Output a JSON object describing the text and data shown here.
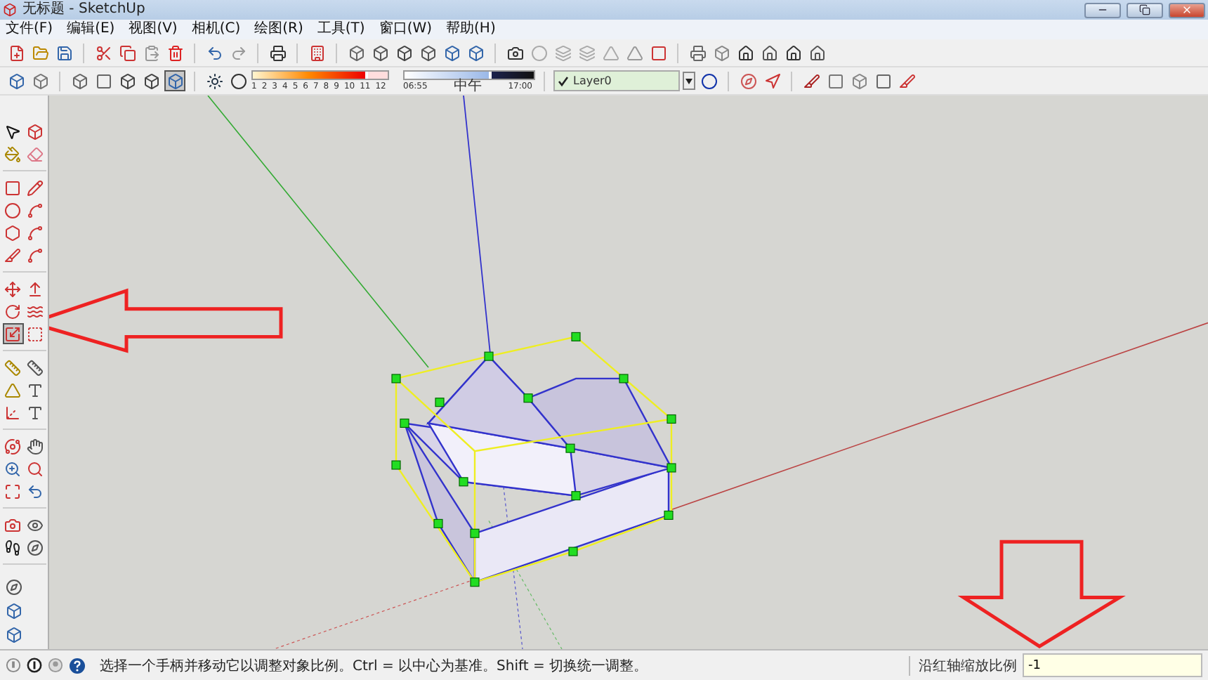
{
  "window": {
    "title": "无标题 - SketchUp"
  },
  "menu": [
    "文件(F)",
    "编辑(E)",
    "视图(V)",
    "相机(C)",
    "绘图(R)",
    "工具(T)",
    "窗口(W)",
    "帮助(H)"
  ],
  "shadow_settings": {
    "month_slider": {
      "level": 0.83
    },
    "time_slider": {
      "level": 0.65
    },
    "month_ticks": [
      "1",
      "2",
      "3",
      "4",
      "5",
      "6",
      "7",
      "8",
      "9",
      "10",
      "11",
      "12"
    ],
    "time_start": "06:55",
    "time_mid": "中午",
    "time_end": "17:00"
  },
  "layer": {
    "name": "Layer0",
    "checked": true
  },
  "left_toolbar": {
    "groups": [
      {
        "tools": [
          {
            "selected": false
          },
          {
            "selected": false
          },
          {
            "selected": false
          },
          {
            "selected": false
          }
        ]
      },
      {
        "tools": [
          {
            "selected": false
          },
          {
            "selected": false
          },
          {
            "selected": false
          },
          {
            "selected": false
          },
          {
            "selected": false
          },
          {
            "selected": false
          },
          {
            "selected": false
          },
          {
            "selected": false
          }
        ]
      },
      {
        "tools": [
          {
            "selected": false
          },
          {
            "selected": false
          },
          {
            "selected": false
          },
          {
            "selected": false
          },
          {
            "selected": true
          },
          {
            "selected": false
          }
        ]
      },
      {
        "tools": [
          {
            "selected": false
          },
          {
            "selected": false
          },
          {
            "selected": false
          },
          {
            "selected": false
          },
          {
            "selected": false
          },
          {
            "selected": false
          }
        ]
      },
      {
        "tools": [
          {
            "selected": false
          },
          {
            "selected": false
          },
          {
            "selected": false
          },
          {
            "selected": false
          },
          {
            "selected": false
          },
          {
            "selected": false
          }
        ]
      },
      {
        "tools": [
          {
            "selected": false
          },
          {
            "selected": false
          },
          {
            "selected": false
          },
          {
            "selected": false
          }
        ]
      }
    ]
  },
  "view_toolbar": {
    "tools": [
      {
        "selected": false
      },
      {
        "selected": false
      },
      {
        "selected": true
      }
    ]
  },
  "status_bar": {
    "hint": "选择一个手柄并移动它以调整对象比例。Ctrl = 以中心为基准。Shift = 切换统一调整。",
    "measurement_label": "沿红轴缩放比例",
    "measurement_value": "-1"
  }
}
